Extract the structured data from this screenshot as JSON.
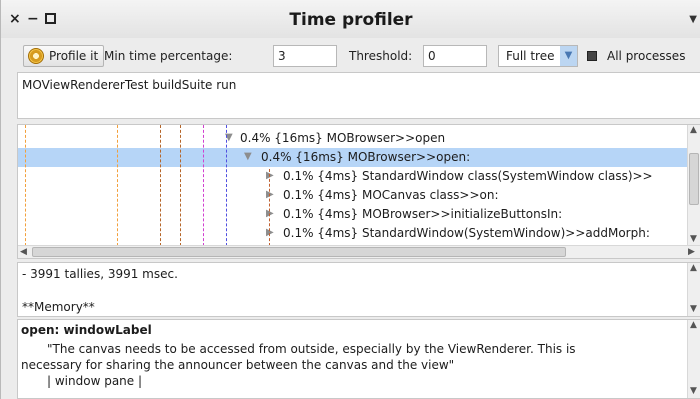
{
  "window": {
    "title": "Time profiler"
  },
  "toolbar": {
    "profile_button": "Profile it",
    "min_time_label": "Min time percentage:",
    "min_time_value": "3",
    "threshold_label": "Threshold:",
    "threshold_value": "0",
    "mode_selected": "Full tree",
    "all_processes_label": "All processes",
    "all_processes_checked": true
  },
  "code": {
    "text": "MOViewRendererTest buildSuite run"
  },
  "tree": {
    "rows": [
      {
        "expanded": true,
        "text": "0.4% {16ms} MOBrowser>>open",
        "selected": false
      },
      {
        "expanded": true,
        "text": "0.4% {16ms} MOBrowser>>open:",
        "selected": true
      },
      {
        "expanded": false,
        "text": "0.1% {4ms} StandardWindow class(SystemWindow class)>>",
        "selected": false
      },
      {
        "expanded": false,
        "text": "0.1% {4ms} MOCanvas class>>on:",
        "selected": false
      },
      {
        "expanded": false,
        "text": "0.1% {4ms} MOBrowser>>initializeButtonsIn:",
        "selected": false
      },
      {
        "expanded": false,
        "text": "0.1% {4ms} StandardWindow(SystemWindow)>>addMorph:",
        "selected": false
      }
    ],
    "guide_colors": [
      "#f2a03c",
      "#f2a03c",
      "#b5662a",
      "#b5662a",
      "#d040d0",
      "#5050e0"
    ]
  },
  "stats": {
    "tallies": "- 3991 tallies, 3991 msec.",
    "memory_header": "**Memory**"
  },
  "source": {
    "title": "open: windowLabel",
    "line1": "\"The canvas needs to be accessed from outside, especially by the ViewRenderer. This is",
    "line2": "necessary for sharing the announcer between the canvas and the view\"",
    "line3": "| window pane |"
  },
  "icons": {
    "close": "×",
    "minimize": "−",
    "expanded_triangle": "▼",
    "collapsed_triangle": "▶",
    "dropdown": "▼"
  }
}
